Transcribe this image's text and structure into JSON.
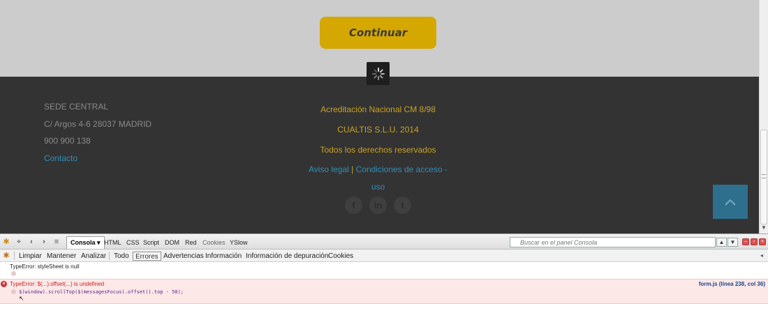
{
  "page": {
    "continue_label": "Continuar",
    "footer_left": {
      "hq": "SEDE CENTRAL",
      "address": "C/ Argos 4-6 28037 MADRID",
      "phone": "900 900 138",
      "contact": "Contacto"
    },
    "footer_center": {
      "accreditation": "Acreditación Nacional CM 8/98",
      "company": "CUALTIS S.L.U. 2014",
      "rights": "Todos los derechos reservados",
      "legal": "Aviso legal",
      "separator": "|",
      "terms_a": "Condiciones de acceso -",
      "terms_b": "uso"
    },
    "social": {
      "facebook": "f",
      "linkedin": "in",
      "twitter": "t"
    },
    "colors": {
      "button": "#d4a800",
      "footer_bg": "#333333",
      "footer_gold": "#c9a227",
      "footer_link": "#2f8fb8",
      "to_top": "#2e6f8e"
    }
  },
  "firebug": {
    "tabs": {
      "console": "Consola",
      "html": "HTML",
      "css": "CSS",
      "script": "Script",
      "dom": "DOM",
      "net": "Red",
      "cookies": "Cookies",
      "yslow": "YSlow"
    },
    "search_placeholder": "Buscar en el panel Consola",
    "filters": {
      "clear": "Limpiar",
      "persist": "Mantener",
      "profile": "Analizar",
      "all": "Todo",
      "errors": "Errores",
      "warnings": "Advertencias",
      "info": "Información",
      "debug": "Información de depuración",
      "cookies": "Cookies"
    },
    "log": {
      "msg1": "TypeError: styleSheet is null",
      "error_msg": "TypeError: $(...).offset(...) is undefined",
      "error_file": "form.js (línea 238, col 36)",
      "error_code": "$(window).scrollTop($(messagesFocus).offset().top - 50);"
    }
  }
}
